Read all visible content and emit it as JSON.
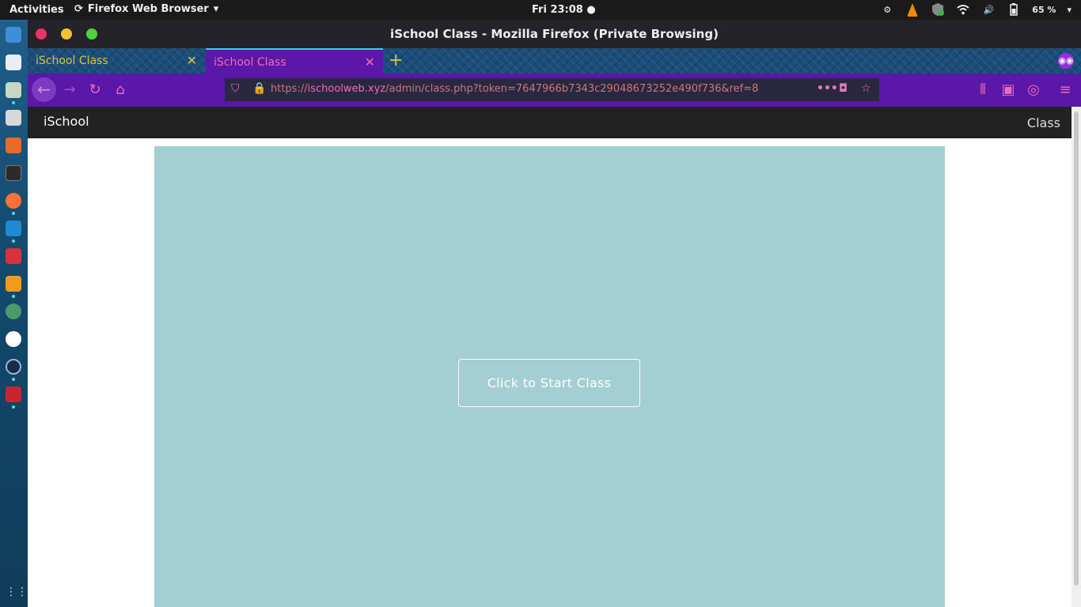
{
  "topbar": {
    "activities": "Activities",
    "app_name": "Firefox Web Browser",
    "clock": "Fri 23:08 ●",
    "battery": "65 %"
  },
  "window": {
    "title": "iSchool Class - Mozilla Firefox (Private Browsing)"
  },
  "tabs": [
    {
      "label": "iSchool Class"
    },
    {
      "label": "iSchool Class"
    }
  ],
  "urlbar": {
    "url_prefix": "https://",
    "url_host": "ischoolweb.xyz",
    "url_path": "/admin/class.php?token=7647966b7343c29048673252e490f736&ref=8"
  },
  "site": {
    "brand": "iSchool",
    "nav_link": "Class",
    "start_button": "Click to Start Class"
  },
  "colors": {
    "tab_active_bg": "#5a17a8",
    "stage_bg": "#a3cfd4",
    "accent_pink": "#f06ab8",
    "tab_inactive_text": "#d8c43f"
  }
}
